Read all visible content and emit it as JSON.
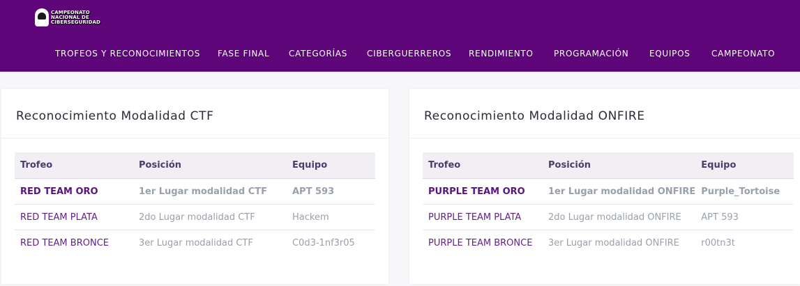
{
  "header": {
    "logo_lines": [
      "CAMPEONATO",
      "NACIONAL DE",
      "CIBERSEGURIDAD"
    ],
    "background_color": "#5d0579",
    "nav": [
      {
        "label": "TROFEOS Y RECONOCIMIENTOS"
      },
      {
        "label": "FASE FINAL"
      },
      {
        "label": "CATEGORÍAS"
      },
      {
        "label": "CIBERGUERREROS"
      },
      {
        "label": "RENDIMIENTO"
      },
      {
        "label": "PROGRAMACIÓN"
      },
      {
        "label": "EQUIPOS"
      },
      {
        "label": "CAMPEONATO"
      }
    ]
  },
  "ctf": {
    "title": "Reconocimiento Modalidad CTF",
    "columns": [
      "Trofeo",
      "Posición",
      "Equipo"
    ],
    "rows": [
      [
        "RED TEAM ORO",
        "1er Lugar modalidad CTF",
        "APT 593"
      ],
      [
        "RED TEAM PLATA",
        "2do Lugar modalidad CTF",
        "Hackem"
      ],
      [
        "RED TEAM BRONCE",
        "3er Lugar modalidad CTF",
        "C0d3-1nf3r05"
      ]
    ]
  },
  "onfire": {
    "title": "Reconocimiento Modalidad ONFIRE",
    "columns": [
      "Trofeo",
      "Posición",
      "Equipo"
    ],
    "rows": [
      [
        "PURPLE TEAM ORO",
        "1er Lugar modalidad ONFIRE",
        "Purple_Tortoise"
      ],
      [
        "PURPLE TEAM PLATA",
        "2do Lugar modalidad ONFIRE",
        "APT 593"
      ],
      [
        "PURPLE TEAM BRONCE",
        "3er Lugar modalidad ONFIRE",
        "r00tn3t"
      ]
    ]
  }
}
